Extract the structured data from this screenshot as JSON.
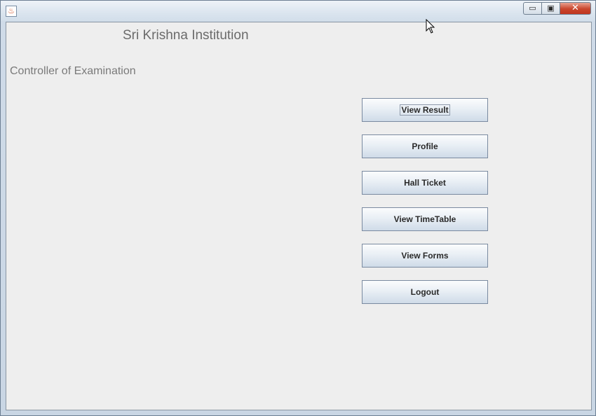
{
  "window": {
    "controls": {
      "minimize": "▭",
      "maximize": "▣",
      "close": "✕"
    },
    "icon": "java-icon"
  },
  "content": {
    "heading": "Sri Krishna Institution",
    "subheading": "Controller of Examination",
    "buttons": [
      {
        "label": "View Result",
        "focused": true
      },
      {
        "label": "Profile"
      },
      {
        "label": "Hall Ticket"
      },
      {
        "label": "View TimeTable"
      },
      {
        "label": "View Forms"
      },
      {
        "label": "Logout"
      }
    ]
  }
}
